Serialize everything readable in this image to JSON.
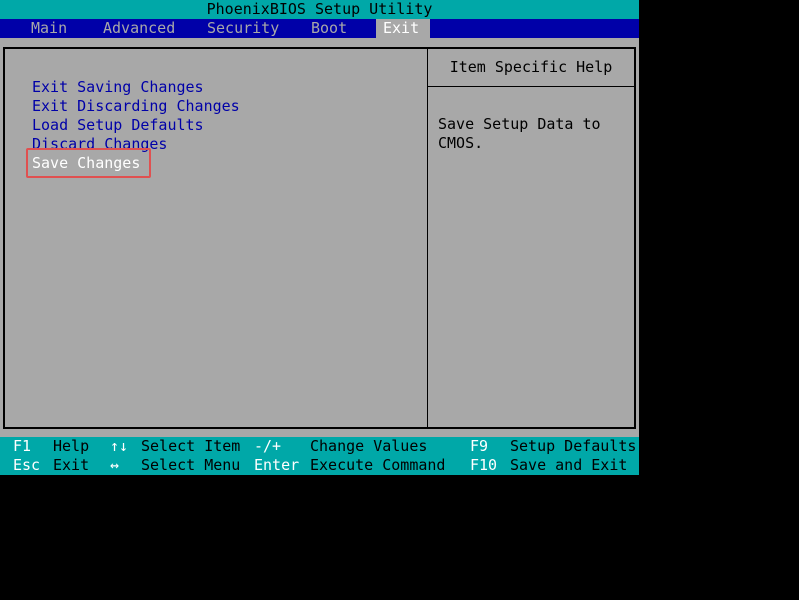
{
  "title": "PhoenixBIOS Setup Utility",
  "menu": {
    "tabs": [
      "Main",
      "Advanced",
      "Security",
      "Boot",
      "Exit"
    ],
    "active": "Exit"
  },
  "exit_menu": {
    "items": [
      "Exit Saving Changes",
      "Exit Discarding Changes",
      "Load Setup Defaults",
      "Discard Changes",
      "Save Changes"
    ],
    "selected": "Save Changes"
  },
  "help": {
    "header": "Item Specific Help",
    "text": "Save Setup Data to\nCMOS."
  },
  "status_bar": {
    "row1": {
      "f1_key": "F1",
      "f1_desc": "Help",
      "arrows_ud_key": "↑↓",
      "arrows_ud_desc": "Select Item",
      "change_key": "-/+",
      "change_desc": "Change Values",
      "f9_key": "F9",
      "f9_desc": "Setup Defaults"
    },
    "row2": {
      "esc_key": "Esc",
      "esc_desc": "Exit",
      "arrows_lr_key": "↔",
      "arrows_lr_desc": "Select Menu",
      "enter_key": "Enter",
      "enter_desc": "Execute Command",
      "f10_key": "F10",
      "f10_desc": "Save and Exit"
    }
  },
  "colors": {
    "background": "#000000",
    "panel": "#a8a8a8",
    "title_bar": "#00a8a8",
    "menu_bar": "#0000a8",
    "item_text": "#0000a8",
    "selected_text": "#ffffff",
    "highlight_outline": "#e05050"
  }
}
